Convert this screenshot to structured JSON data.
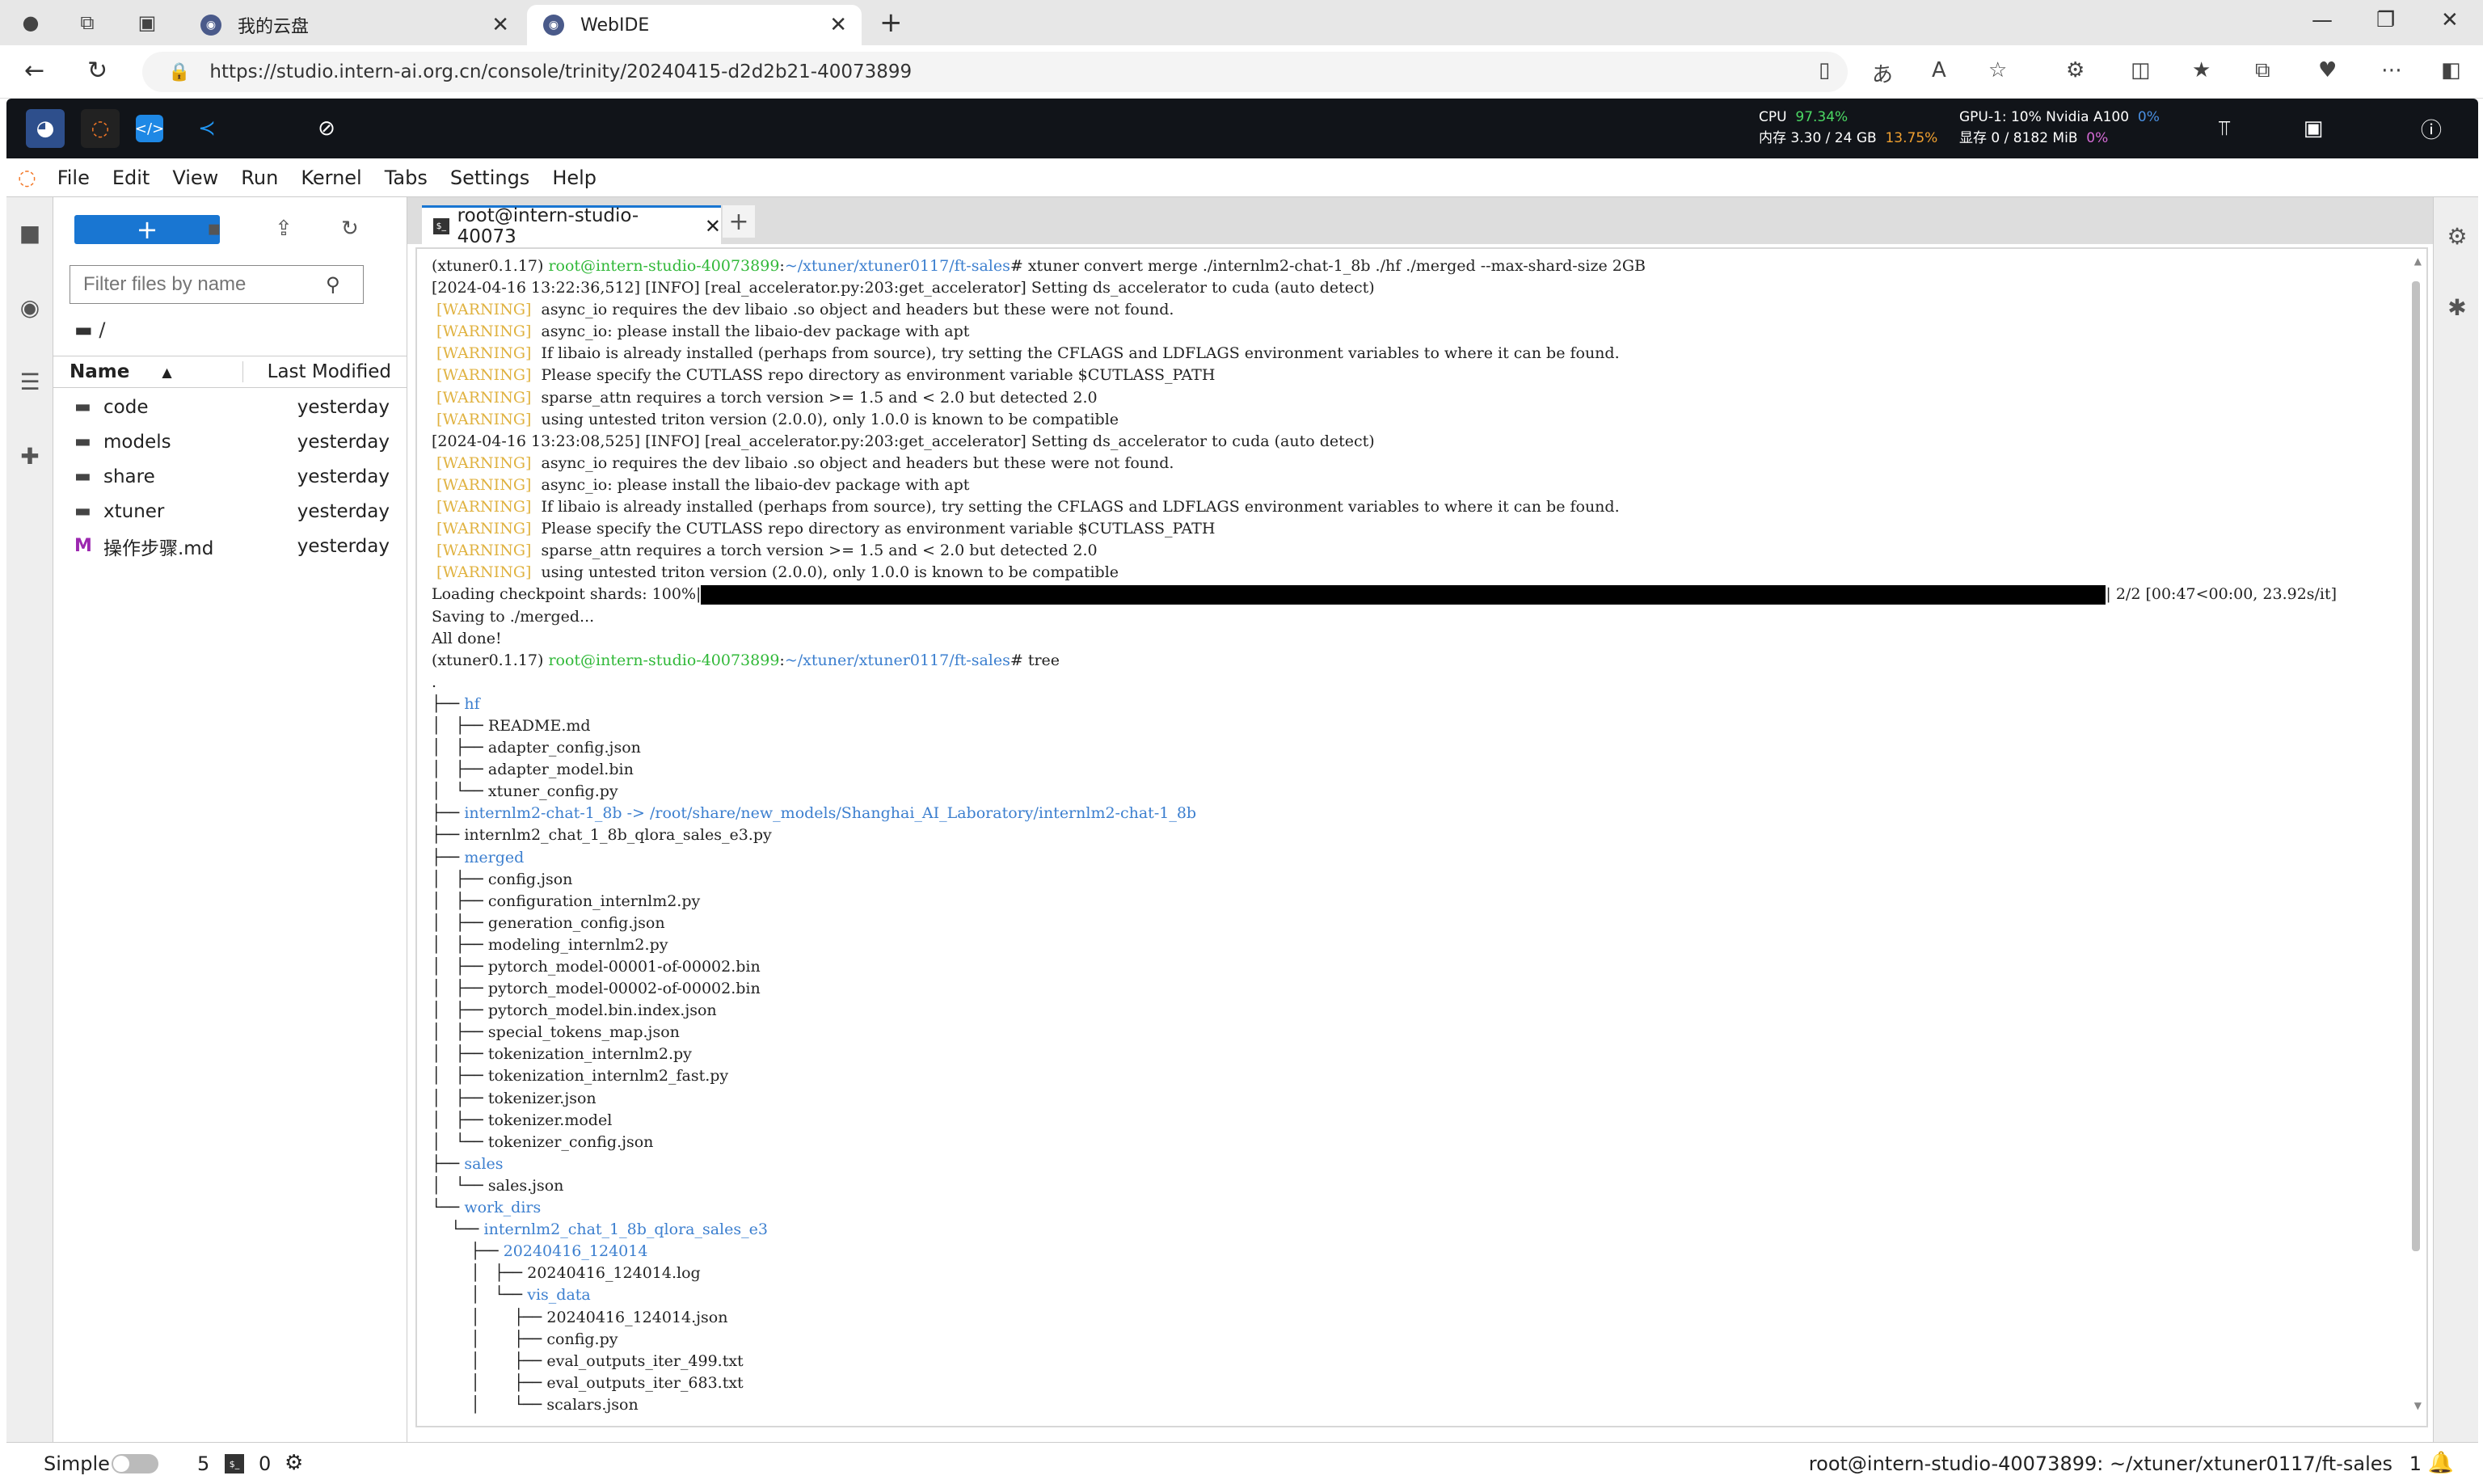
{
  "browser": {
    "tabs": [
      {
        "title": "我的云盘"
      },
      {
        "title": "WebIDE"
      }
    ],
    "url": "https://studio.intern-ai.org.cn/console/trinity/20240415-d2d2b21-40073899"
  },
  "studio": {
    "cpu_label": "CPU",
    "cpu_value": "97.34%",
    "mem_label": "内存 3.30 / 24 GB",
    "mem_value": "13.75%",
    "gpu_label": "GPU-1: 10% Nvidia A100",
    "gpu_value": "0%",
    "vram_label": "显存 0 / 8182 MiB",
    "vram_value": "0%"
  },
  "menu": [
    "File",
    "Edit",
    "View",
    "Run",
    "Kernel",
    "Tabs",
    "Settings",
    "Help"
  ],
  "filebrowser": {
    "new_label": "+",
    "filter_placeholder": "Filter files by name",
    "breadcrumb": "/",
    "col_name": "Name",
    "col_modified": "Last Modified",
    "files": [
      {
        "name": "code",
        "modified": "yesterday",
        "icon": "folder-icon"
      },
      {
        "name": "models",
        "modified": "yesterday",
        "icon": "folder-icon"
      },
      {
        "name": "share",
        "modified": "yesterday",
        "icon": "folder-icon"
      },
      {
        "name": "xtuner",
        "modified": "yesterday",
        "icon": "folder-icon"
      },
      {
        "name": "操作步骤.md",
        "modified": "yesterday",
        "icon": "markdown-icon"
      }
    ]
  },
  "terminal": {
    "tab_title": "root@intern-studio-40073",
    "progress_suffix": "| 2/2 [00:47<00:00, 23.92s/it]",
    "lines": [
      [
        {
          "t": "(xtuner0.1.17) "
        },
        {
          "t": "root@intern-studio-40073899",
          "c": "g"
        },
        {
          "t": ":"
        },
        {
          "t": "~/xtuner/xtuner0117/ft-sales",
          "c": "b"
        },
        {
          "t": "# xtuner convert merge ./internlm2-chat-1_8b ./hf ./merged --max-shard-size 2GB"
        }
      ],
      [
        {
          "t": "[2024-04-16 13:22:36,512] [INFO] [real_accelerator.py:203:get_accelerator] Setting ds_accelerator to cuda (auto detect)"
        }
      ],
      [
        {
          "t": " [WARNING] ",
          "c": "y"
        },
        {
          "t": " async_io requires the dev libaio .so object and headers but these were not found."
        }
      ],
      [
        {
          "t": " [WARNING] ",
          "c": "y"
        },
        {
          "t": " async_io: please install the libaio-dev package with apt"
        }
      ],
      [
        {
          "t": " [WARNING] ",
          "c": "y"
        },
        {
          "t": " If libaio is already installed (perhaps from source), try setting the CFLAGS and LDFLAGS environment variables to where it can be found."
        }
      ],
      [
        {
          "t": " [WARNING] ",
          "c": "y"
        },
        {
          "t": " Please specify the CUTLASS repo directory as environment variable $CUTLASS_PATH"
        }
      ],
      [
        {
          "t": " [WARNING] ",
          "c": "y"
        },
        {
          "t": " sparse_attn requires a torch version >= 1.5 and < 2.0 but detected 2.0"
        }
      ],
      [
        {
          "t": " [WARNING] ",
          "c": "y"
        },
        {
          "t": " using untested triton version (2.0.0), only 1.0.0 is known to be compatible"
        }
      ],
      [
        {
          "t": "[2024-04-16 13:23:08,525] [INFO] [real_accelerator.py:203:get_accelerator] Setting ds_accelerator to cuda (auto detect)"
        }
      ],
      [
        {
          "t": " [WARNING] ",
          "c": "y"
        },
        {
          "t": " async_io requires the dev libaio .so object and headers but these were not found."
        }
      ],
      [
        {
          "t": " [WARNING] ",
          "c": "y"
        },
        {
          "t": " async_io: please install the libaio-dev package with apt"
        }
      ],
      [
        {
          "t": " [WARNING] ",
          "c": "y"
        },
        {
          "t": " If libaio is already installed (perhaps from source), try setting the CFLAGS and LDFLAGS environment variables to where it can be found."
        }
      ],
      [
        {
          "t": " [WARNING] ",
          "c": "y"
        },
        {
          "t": " Please specify the CUTLASS repo directory as environment variable $CUTLASS_PATH"
        }
      ],
      [
        {
          "t": " [WARNING] ",
          "c": "y"
        },
        {
          "t": " sparse_attn requires a torch version >= 1.5 and < 2.0 but detected 2.0"
        }
      ],
      [
        {
          "t": " [WARNING] ",
          "c": "y"
        },
        {
          "t": " using untested triton version (2.0.0), only 1.0.0 is known to be compatible"
        }
      ],
      [
        {
          "t": "Loading checkpoint shards: 100%|"
        },
        {
          "t": "",
          "c": "bar"
        }
      ],
      [
        {
          "t": "Saving to ./merged..."
        }
      ],
      [
        {
          "t": "All done!"
        }
      ],
      [
        {
          "t": "(xtuner0.1.17) "
        },
        {
          "t": "root@intern-studio-40073899",
          "c": "g"
        },
        {
          "t": ":"
        },
        {
          "t": "~/xtuner/xtuner0117/ft-sales",
          "c": "b"
        },
        {
          "t": "# tree"
        }
      ],
      [
        {
          "t": "."
        }
      ],
      [
        {
          "t": "├── "
        },
        {
          "t": "hf",
          "c": "b"
        }
      ],
      [
        {
          "t": "│   ├── README.md"
        }
      ],
      [
        {
          "t": "│   ├── adapter_config.json"
        }
      ],
      [
        {
          "t": "│   ├── adapter_model.bin"
        }
      ],
      [
        {
          "t": "│   └── xtuner_config.py"
        }
      ],
      [
        {
          "t": "├── "
        },
        {
          "t": "internlm2-chat-1_8b -> /root/share/new_models/Shanghai_AI_Laboratory/internlm2-chat-1_8b",
          "c": "b"
        }
      ],
      [
        {
          "t": "├── internlm2_chat_1_8b_qlora_sales_e3.py"
        }
      ],
      [
        {
          "t": "├── "
        },
        {
          "t": "merged",
          "c": "b"
        }
      ],
      [
        {
          "t": "│   ├── config.json"
        }
      ],
      [
        {
          "t": "│   ├── configuration_internlm2.py"
        }
      ],
      [
        {
          "t": "│   ├── generation_config.json"
        }
      ],
      [
        {
          "t": "│   ├── modeling_internlm2.py"
        }
      ],
      [
        {
          "t": "│   ├── pytorch_model-00001-of-00002.bin"
        }
      ],
      [
        {
          "t": "│   ├── pytorch_model-00002-of-00002.bin"
        }
      ],
      [
        {
          "t": "│   ├── pytorch_model.bin.index.json"
        }
      ],
      [
        {
          "t": "│   ├── special_tokens_map.json"
        }
      ],
      [
        {
          "t": "│   ├── tokenization_internlm2.py"
        }
      ],
      [
        {
          "t": "│   ├── tokenization_internlm2_fast.py"
        }
      ],
      [
        {
          "t": "│   ├── tokenizer.json"
        }
      ],
      [
        {
          "t": "│   ├── tokenizer.model"
        }
      ],
      [
        {
          "t": "│   └── tokenizer_config.json"
        }
      ],
      [
        {
          "t": "├── "
        },
        {
          "t": "sales",
          "c": "b"
        }
      ],
      [
        {
          "t": "│   └── sales.json"
        }
      ],
      [
        {
          "t": "└── "
        },
        {
          "t": "work_dirs",
          "c": "b"
        }
      ],
      [
        {
          "t": "    └── "
        },
        {
          "t": "internlm2_chat_1_8b_qlora_sales_e3",
          "c": "b"
        }
      ],
      [
        {
          "t": "        ├── "
        },
        {
          "t": "20240416_124014",
          "c": "b"
        }
      ],
      [
        {
          "t": "        │   ├── 20240416_124014.log"
        }
      ],
      [
        {
          "t": "        │   └── "
        },
        {
          "t": "vis_data",
          "c": "b"
        }
      ],
      [
        {
          "t": "        │       ├── 20240416_124014.json"
        }
      ],
      [
        {
          "t": "        │       ├── config.py"
        }
      ],
      [
        {
          "t": "        │       ├── eval_outputs_iter_499.txt"
        }
      ],
      [
        {
          "t": "        │       ├── eval_outputs_iter_683.txt"
        }
      ],
      [
        {
          "t": "        │       └── scalars.json"
        }
      ]
    ]
  },
  "statusbar": {
    "mode": "Simple",
    "count1": "5",
    "count2": "0",
    "path": "root@intern-studio-40073899: ~/xtuner/xtuner0117/ft-sales",
    "line": "1"
  }
}
